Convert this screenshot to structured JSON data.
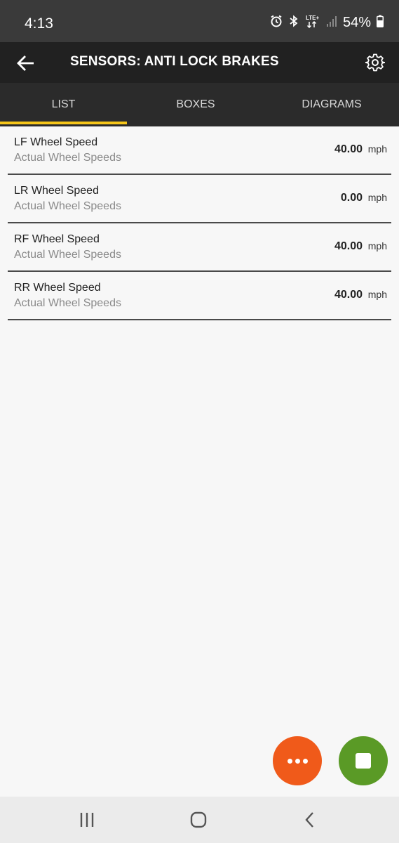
{
  "status_bar": {
    "time": "4:13",
    "signal_text": "LTE+",
    "battery": "54%"
  },
  "app_bar": {
    "title": "SENSORS: ANTI LOCK BRAKES",
    "back_icon": "arrow-left-icon",
    "settings_icon": "gear-icon"
  },
  "tabs": [
    {
      "label": "LIST",
      "active": true
    },
    {
      "label": "BOXES",
      "active": false
    },
    {
      "label": "DIAGRAMS",
      "active": false
    }
  ],
  "sensors": [
    {
      "name": "LF Wheel Speed",
      "group": "Actual Wheel Speeds",
      "value": "40.00",
      "unit": "mph"
    },
    {
      "name": "LR Wheel Speed",
      "group": "Actual Wheel Speeds",
      "value": "0.00",
      "unit": "mph"
    },
    {
      "name": "RF Wheel Speed",
      "group": "Actual Wheel Speeds",
      "value": "40.00",
      "unit": "mph"
    },
    {
      "name": "RR Wheel Speed",
      "group": "Actual Wheel Speeds",
      "value": "40.00",
      "unit": "mph"
    }
  ],
  "colors": {
    "accent": "#f5c518",
    "more_fab": "#f05a1a",
    "stop_fab": "#5a9a26"
  }
}
